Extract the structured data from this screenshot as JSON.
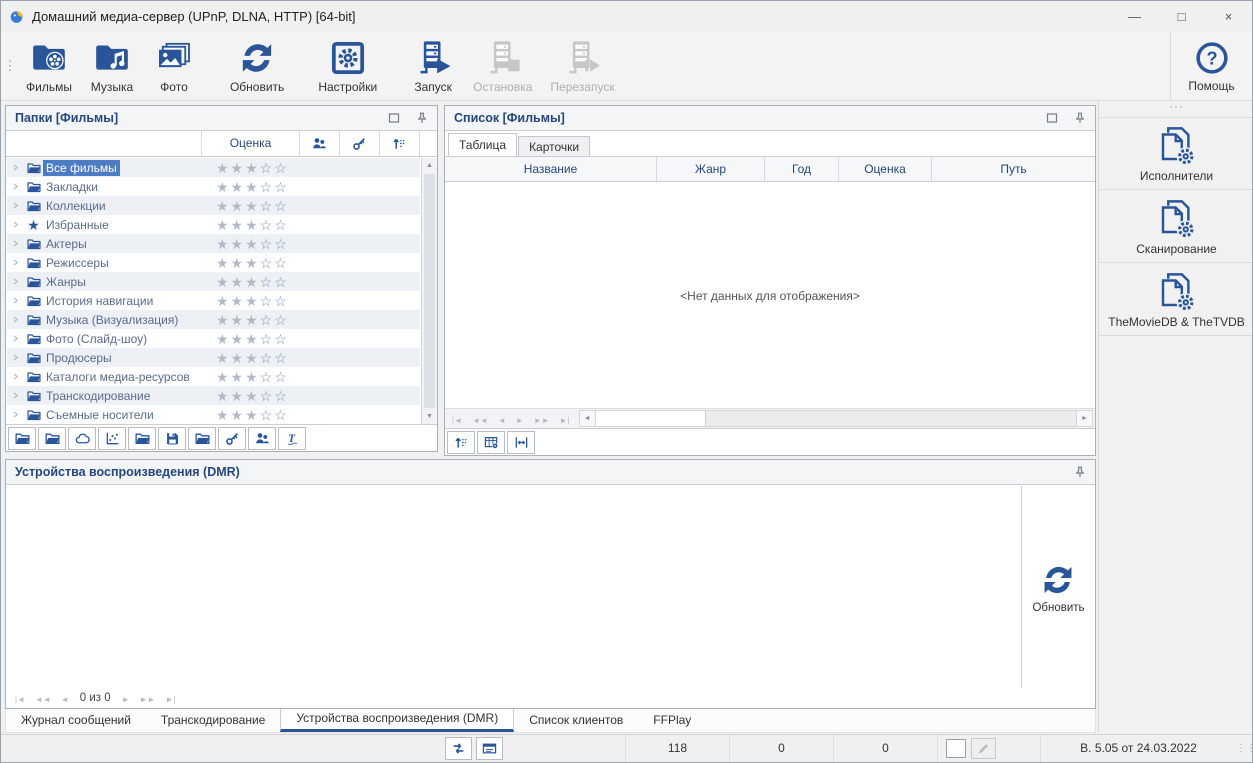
{
  "titlebar": {
    "title": "Домашний медиа-сервер (UPnP, DLNA, HTTP) [64-bit]"
  },
  "window_controls": {
    "minimize": "—",
    "maximize": "□",
    "close": "×"
  },
  "toolbar": {
    "handle": "⋮",
    "items": [
      {
        "label": "Фильмы",
        "icon": "movies-icon",
        "enabled": true
      },
      {
        "label": "Музыка",
        "icon": "music-icon",
        "enabled": true
      },
      {
        "label": "Фото",
        "icon": "photo-icon",
        "enabled": true
      },
      {
        "label": "Обновить",
        "icon": "refresh-icon",
        "enabled": true
      },
      {
        "label": "Настройки",
        "icon": "settings-icon",
        "enabled": true
      },
      {
        "label": "Запуск",
        "icon": "start-server-icon",
        "enabled": true
      },
      {
        "label": "Остановка",
        "icon": "stop-server-icon",
        "enabled": false
      },
      {
        "label": "Перезапуск",
        "icon": "restart-server-icon",
        "enabled": false
      }
    ],
    "help": {
      "label": "Помощь",
      "icon": "help-icon"
    }
  },
  "folders_panel": {
    "title": "Папки [Фильмы]",
    "rating_column_label": "Оценка",
    "max_stars": 5,
    "items": [
      {
        "label": "Все фильмы",
        "icon": "all-movies-folder-icon",
        "rating": 3,
        "selected": true
      },
      {
        "label": "Закладки",
        "icon": "bookmarks-folder-icon",
        "rating": 3
      },
      {
        "label": "Коллекции",
        "icon": "collections-folder-icon",
        "rating": 3
      },
      {
        "label": "Избранные",
        "icon": "favorites-star-icon",
        "rating": 3
      },
      {
        "label": "Актеры",
        "icon": "actors-folder-icon",
        "rating": 3
      },
      {
        "label": "Режиссеры",
        "icon": "directors-folder-icon",
        "rating": 3
      },
      {
        "label": "Жанры",
        "icon": "genres-folder-icon",
        "rating": 3
      },
      {
        "label": "История навигации",
        "icon": "history-folder-icon",
        "rating": 3
      },
      {
        "label": "Музыка (Визуализация)",
        "icon": "music-folder-icon",
        "rating": 3
      },
      {
        "label": "Фото (Слайд-шоу)",
        "icon": "photo-folder-icon",
        "rating": 3
      },
      {
        "label": "Продюсеры",
        "icon": "producers-folder-icon",
        "rating": 3
      },
      {
        "label": "Каталоги медиа-ресурсов",
        "icon": "catalogs-folder-icon",
        "rating": 3
      },
      {
        "label": "Транскодирование",
        "icon": "transcode-folder-icon",
        "rating": 3
      },
      {
        "label": "Съемные носители",
        "icon": "removable-media-folder-icon",
        "rating": 3
      }
    ],
    "header_buttons": [
      "users-icon",
      "key-icon",
      "sort-icon"
    ],
    "toolbar_icons": [
      "open-folder-icon",
      "import-folder-icon",
      "weather-icon",
      "scatter-icon",
      "export-folder-icon",
      "save-icon",
      "refresh-folder-icon",
      "key-icon",
      "users-icon",
      "font-icon"
    ]
  },
  "list_panel": {
    "title": "Список [Фильмы]",
    "tabs": [
      {
        "label": "Таблица",
        "active": true
      },
      {
        "label": "Карточки",
        "active": false
      }
    ],
    "columns": [
      "Название",
      "Жанр",
      "Год",
      "Оценка",
      "Путь"
    ],
    "empty_text": "<Нет данных для отображения>",
    "toolbar_icons": [
      "sort-icon",
      "table-settings-icon",
      "column-width-icon"
    ]
  },
  "side_panel": {
    "handle": "···",
    "items": [
      {
        "label": "Исполнители"
      },
      {
        "label": "Сканирование"
      },
      {
        "label": "TheMovieDB & TheTVDB"
      }
    ]
  },
  "dmr_panel": {
    "title": "Устройства воспроизведения (DMR)",
    "refresh_label": "Обновить",
    "nav_text": "0 из 0"
  },
  "bottom_tabs": {
    "items": [
      "Журнал сообщений",
      "Транскодирование",
      "Устройства воспроизведения (DMR)",
      "Список клиентов",
      "FFPlay"
    ],
    "active_index": 2
  },
  "statusbar": {
    "counters": [
      "118",
      "0",
      "0"
    ],
    "version": "В. 5.05 от 24.03.2022"
  },
  "nav_icons": {
    "left": [
      "|◄",
      "◄◄",
      "◄"
    ],
    "right": [
      "►",
      "►►",
      "►|"
    ]
  },
  "icons": {
    "star_filled": "★",
    "star_empty": "☆",
    "up_arrow": "▲",
    "down_arrow": "▼",
    "left_arrow": "◄",
    "right_arrow": "►",
    "grip": "⋮⋮"
  },
  "colors": {
    "accent_blue": "#2a5699",
    "selection_blue": "#4d7cc5",
    "header_navy": "#26477e"
  }
}
